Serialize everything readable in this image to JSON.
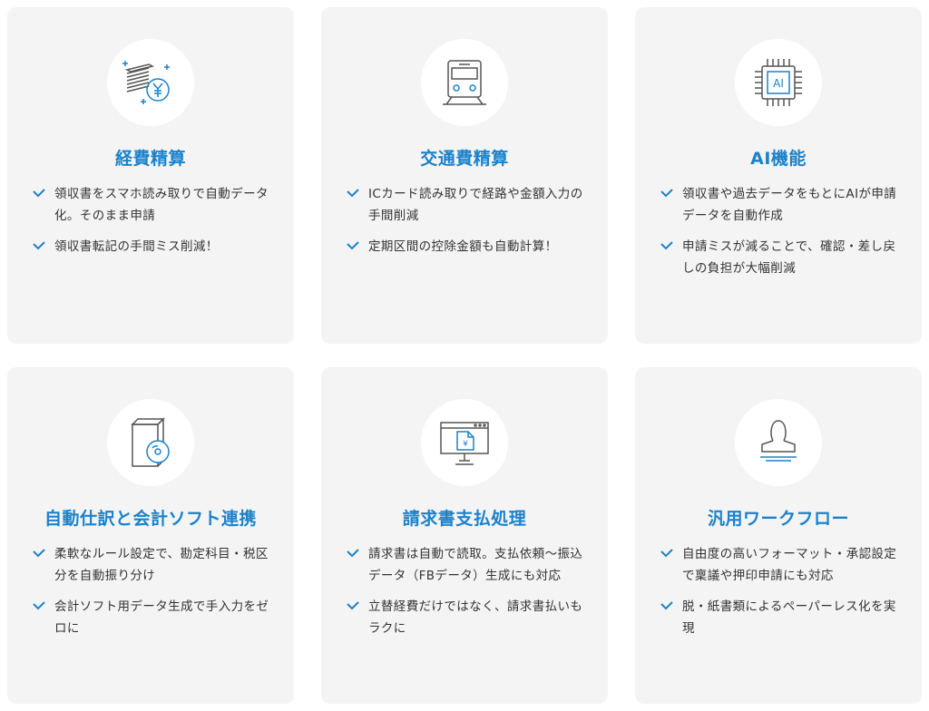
{
  "colors": {
    "accent": "#1a82cc",
    "card_bg": "#f4f4f4",
    "text": "#333333"
  },
  "cards": [
    {
      "icon": "receipt-yen-icon",
      "title": "経費精算",
      "items": [
        "領収書をスマホ読み取りで自動データ化。そのまま申請",
        "領収書転記の手間ミス削減！"
      ]
    },
    {
      "icon": "train-icon",
      "title": "交通費精算",
      "items": [
        "ICカード読み取りで経路や金額入力の手間削減",
        "定期区間の控除金額も自動計算！"
      ]
    },
    {
      "icon": "ai-chip-icon",
      "title": "AI機能",
      "chip_label": "AI",
      "items": [
        "領収書や過去データをもとにAIが申請データを自動作成",
        "申請ミスが減ることで、確認・差し戻しの負担が大幅削減"
      ]
    },
    {
      "icon": "software-box-icon",
      "title": "自動仕訳と会計ソフト連携",
      "items": [
        "柔軟なルール設定で、勘定科目・税区分を自動振り分け",
        "会計ソフト用データ生成で手入力をゼロに"
      ]
    },
    {
      "icon": "invoice-monitor-icon",
      "title": "請求書支払処理",
      "monitor_label": "¥",
      "items": [
        "請求書は自動で読取。支払依頼～振込データ（FBデータ）生成にも対応",
        "立替経費だけではなく、請求書払いもラクに"
      ]
    },
    {
      "icon": "stamp-icon",
      "title": "汎用ワークフロー",
      "items": [
        "自由度の高いフォーマット・承認設定で稟議や押印申請にも対応",
        "脱・紙書類によるペーパーレス化を実現"
      ]
    }
  ]
}
